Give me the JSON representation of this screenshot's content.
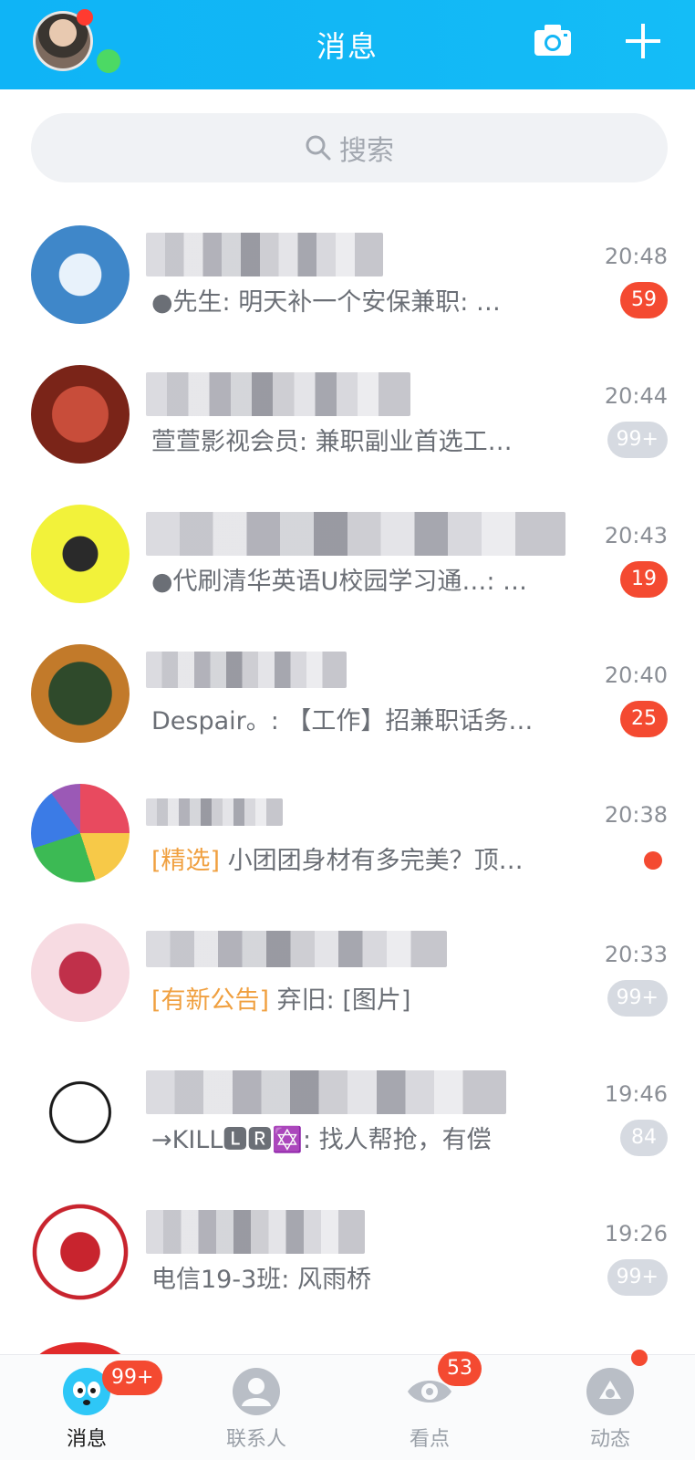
{
  "header": {
    "title": "消息",
    "avatar_icon": "profile-avatar",
    "camera_icon": "camera-icon",
    "add_icon": "plus-icon"
  },
  "search": {
    "placeholder": "搜索",
    "icon": "search-icon"
  },
  "chats": [
    {
      "name": "",
      "preview_tag": "",
      "preview": "●先生: 明天补一个安保兼职: …",
      "time": "20:48",
      "badge": "59",
      "badge_style": "red"
    },
    {
      "name": "",
      "preview_tag": "",
      "preview": "萱萱影视会员: 兼职副业首选工…",
      "time": "20:44",
      "badge": "99+",
      "badge_style": "gray"
    },
    {
      "name": "",
      "preview_tag": "",
      "preview": "●代刷清华英语U校园学习通…: …",
      "time": "20:43",
      "badge": "19",
      "badge_style": "red"
    },
    {
      "name": "",
      "preview_tag": "",
      "preview": "Despair。: 【工作】招兼职话务…",
      "time": "20:40",
      "badge": "25",
      "badge_style": "red"
    },
    {
      "name": "",
      "preview_tag": "[精选]",
      "preview": " 小团团身材有多完美？顶…",
      "time": "20:38",
      "badge": "",
      "badge_style": "dot"
    },
    {
      "name": "",
      "preview_tag": "[有新公告]",
      "preview": " 弃旧: [图片]",
      "time": "20:33",
      "badge": "99+",
      "badge_style": "gray"
    },
    {
      "name": "",
      "preview_tag": "",
      "preview": "→KILL🅻🆁✡️: 找人帮抢，有偿",
      "time": "19:46",
      "badge": "84",
      "badge_style": "gray"
    },
    {
      "name": "",
      "preview_tag": "",
      "preview": "电信19-3班: 风雨桥",
      "time": "19:26",
      "badge": "99+",
      "badge_style": "gray"
    }
  ],
  "tabs": [
    {
      "label": "消息",
      "icon": "messages-tab-icon",
      "badge": "99+",
      "active": true
    },
    {
      "label": "联系人",
      "icon": "contacts-tab-icon",
      "badge": "",
      "active": false
    },
    {
      "label": "看点",
      "icon": "discover-tab-icon",
      "badge": "53",
      "active": false
    },
    {
      "label": "动态",
      "icon": "moments-tab-icon",
      "badge": "",
      "active": false
    }
  ],
  "colors": {
    "header": "#12b7f5",
    "badge_red": "#f44a31",
    "badge_gray": "#d6dae1",
    "tag_orange": "#f0a040"
  }
}
